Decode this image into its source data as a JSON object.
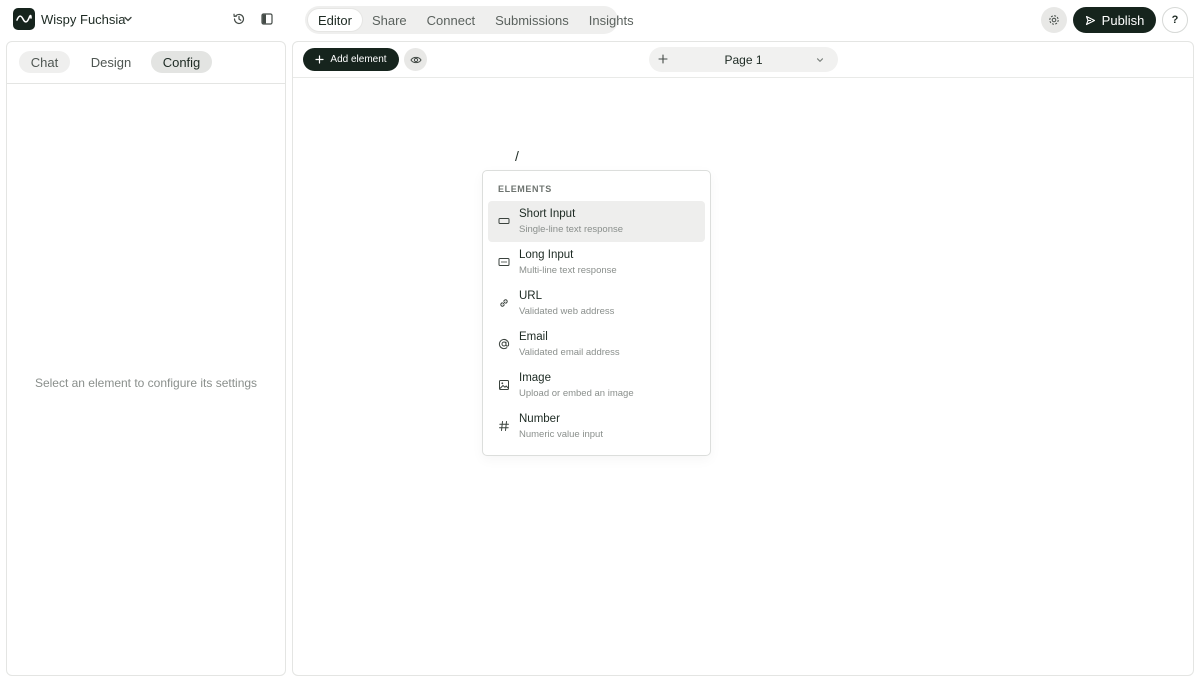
{
  "header": {
    "project_name": "Wispy Fuchsia",
    "tabs": [
      {
        "label": "Editor",
        "active": true
      },
      {
        "label": "Share",
        "active": false
      },
      {
        "label": "Connect",
        "active": false
      },
      {
        "label": "Submissions",
        "active": false
      },
      {
        "label": "Insights",
        "active": false
      }
    ],
    "publish_label": "Publish",
    "help_label": "?"
  },
  "sidebar": {
    "tabs": [
      {
        "label": "Chat"
      },
      {
        "label": "Design"
      },
      {
        "label": "Config",
        "active": true
      }
    ],
    "empty_message": "Select an element to configure its settings"
  },
  "canvas": {
    "add_element_label": "Add element",
    "page_label": "Page 1",
    "slash_text": "/"
  },
  "dropdown": {
    "header": "ELEMENTS",
    "items": [
      {
        "title": "Short Input",
        "description": "Single-line text response",
        "icon": "short-input-icon",
        "highlighted": true
      },
      {
        "title": "Long Input",
        "description": "Multi-line text response",
        "icon": "long-input-icon"
      },
      {
        "title": "URL",
        "description": "Validated web address",
        "icon": "link-icon"
      },
      {
        "title": "Email",
        "description": "Validated email address",
        "icon": "at-icon"
      },
      {
        "title": "Image",
        "description": "Upload or embed an image",
        "icon": "image-icon"
      },
      {
        "title": "Number",
        "description": "Numeric value input",
        "icon": "hash-icon"
      }
    ]
  },
  "colors": {
    "brand_dark": "#16241d",
    "muted_bg": "#efefee",
    "border": "#e4e5e3"
  }
}
